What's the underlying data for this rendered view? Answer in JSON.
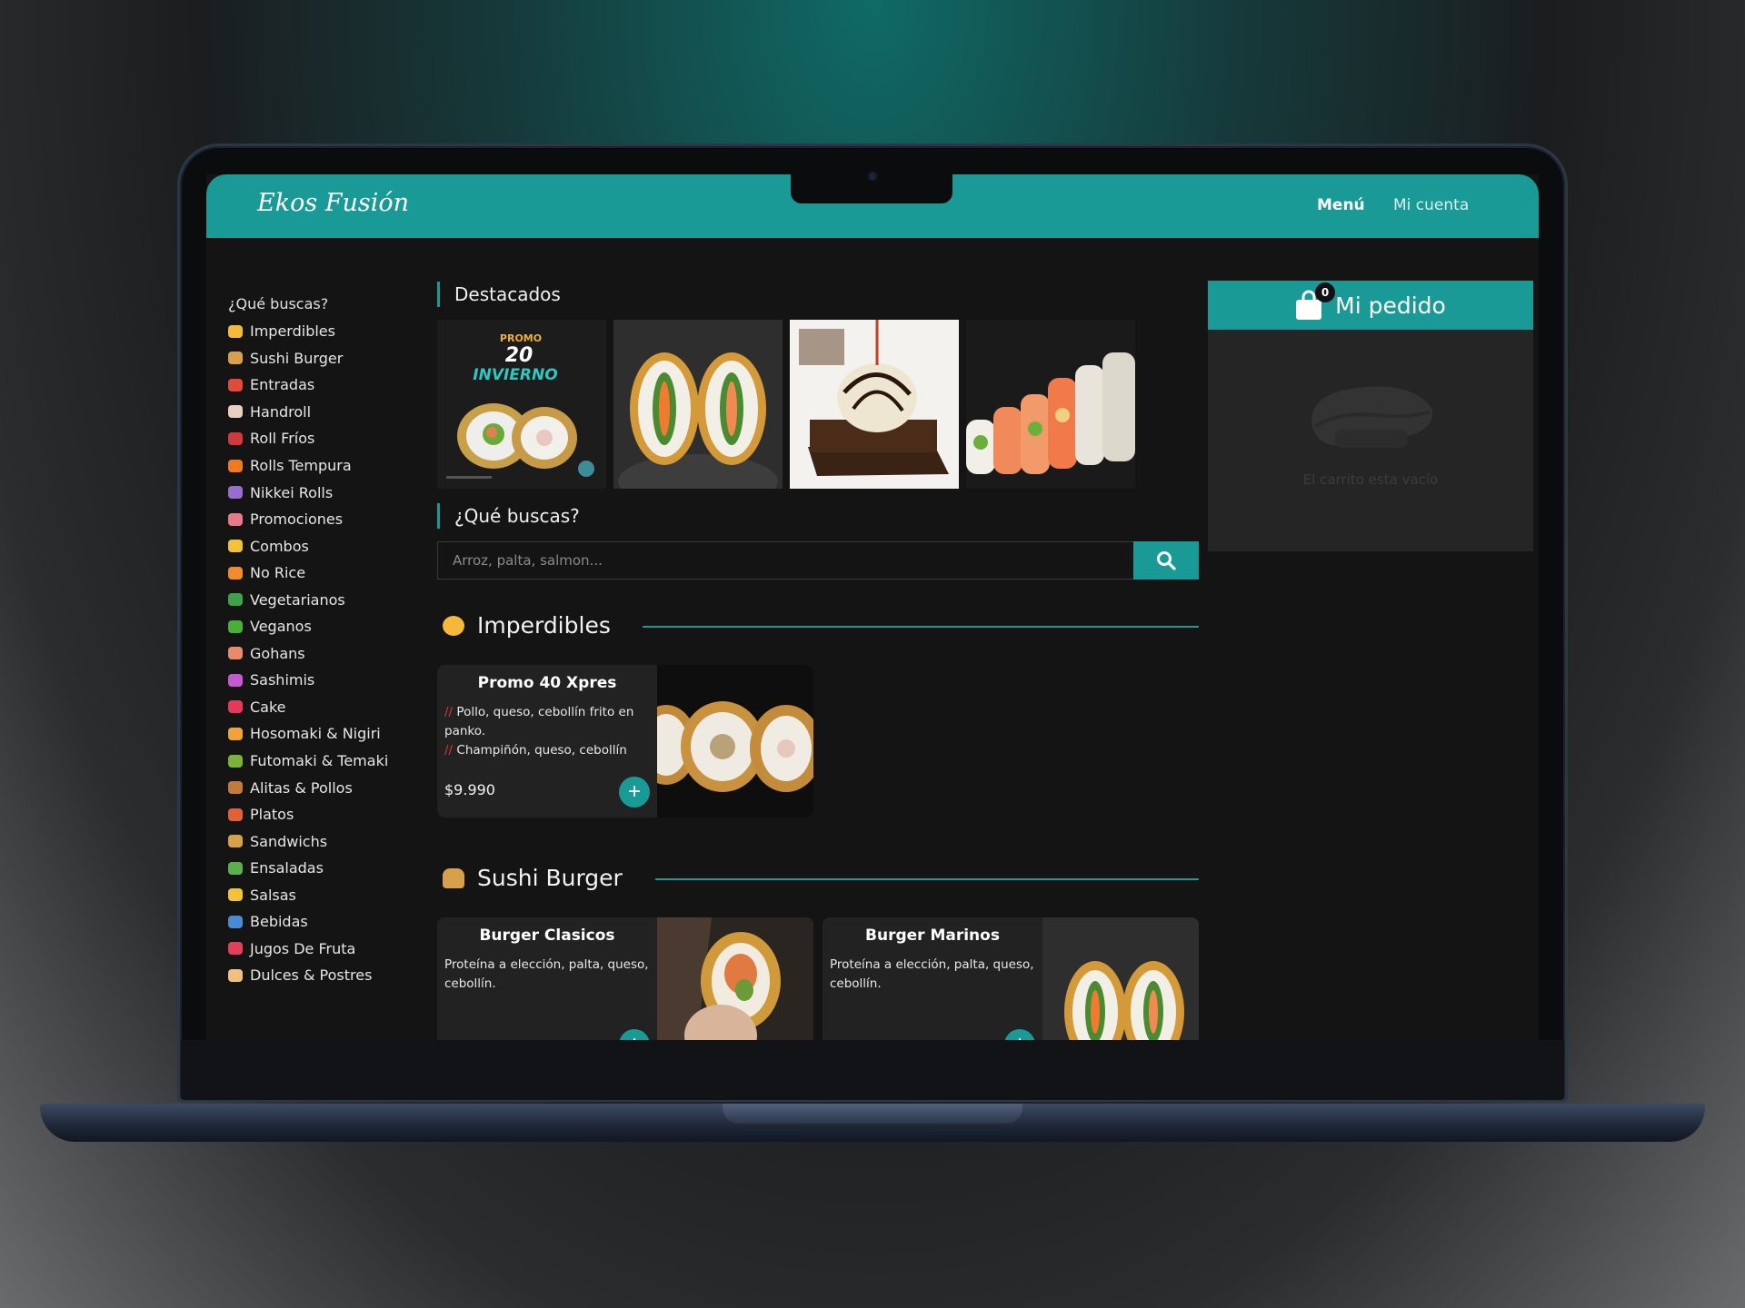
{
  "app": {
    "brand": "Ekos Fusión"
  },
  "nav": {
    "menu": "Menú",
    "account": "Mi cuenta"
  },
  "sidebar": {
    "heading": "¿Qué buscas?",
    "items": [
      {
        "label": "Imperdibles",
        "icon": "party-face-icon",
        "color": "#f5b83b"
      },
      {
        "label": "Sushi Burger",
        "icon": "burger-icon",
        "color": "#d8a04a"
      },
      {
        "label": "Entradas",
        "icon": "fries-icon",
        "color": "#e24a3b"
      },
      {
        "label": "Handroll",
        "icon": "pill-icon",
        "color": "#e8d0c0"
      },
      {
        "label": "Roll Fríos",
        "icon": "chopsticks-icon",
        "color": "#d03a3a"
      },
      {
        "label": "Rolls Tempura",
        "icon": "fire-icon",
        "color": "#f07a22"
      },
      {
        "label": "Nikkei Rolls",
        "icon": "peru-flag-icon",
        "color": "#9a6cd0"
      },
      {
        "label": "Promociones",
        "icon": "sushi-icon",
        "color": "#e67a8a"
      },
      {
        "label": "Combos",
        "icon": "dizzy-icon",
        "color": "#f2c23a"
      },
      {
        "label": "No Rice",
        "icon": "orange-heart-icon",
        "color": "#f28a2e"
      },
      {
        "label": "Vegetarianos",
        "icon": "shamrock-icon",
        "color": "#3fa24a"
      },
      {
        "label": "Veganos",
        "icon": "green-pepper-icon",
        "color": "#4cae3a"
      },
      {
        "label": "Gohans",
        "icon": "rice-bowl-icon",
        "color": "#e98a6a"
      },
      {
        "label": "Sashimis",
        "icon": "octopus-icon",
        "color": "#c35ad0"
      },
      {
        "label": "Cake",
        "icon": "heart-icon",
        "color": "#e8385a"
      },
      {
        "label": "Hosomaki & Nigiri",
        "icon": "mango-icon",
        "color": "#f3a23a"
      },
      {
        "label": "Futomaki & Temaki",
        "icon": "avocado-icon",
        "color": "#7ab23a"
      },
      {
        "label": "Alitas & Pollos",
        "icon": "drumstick-icon",
        "color": "#c47a3a"
      },
      {
        "label": "Platos",
        "icon": "noodles-icon",
        "color": "#e0603a"
      },
      {
        "label": "Sandwichs",
        "icon": "sandwich-icon",
        "color": "#d8a04a"
      },
      {
        "label": "Ensaladas",
        "icon": "salad-icon",
        "color": "#5ab04a"
      },
      {
        "label": "Salsas",
        "icon": "sparkles-icon",
        "color": "#f2c23a"
      },
      {
        "label": "Bebidas",
        "icon": "picture-icon",
        "color": "#4a8ad0"
      },
      {
        "label": "Jugos De Fruta",
        "icon": "cup-icon",
        "color": "#e0405a"
      },
      {
        "label": "Dulces & Postres",
        "icon": "cake-slice-icon",
        "color": "#f0c080"
      }
    ]
  },
  "featured": {
    "title": "Destacados",
    "promo": {
      "line1": "PROMO",
      "line2": "20",
      "line3": "INVIERNO"
    }
  },
  "search": {
    "title": "¿Qué buscas?",
    "placeholder": "Arroz, palta, salmon..."
  },
  "categories": {
    "imperdibles": {
      "title": "Imperdibles",
      "products": [
        {
          "name": "Promo 40 Xpres",
          "desc1": "Pollo, queso, cebollín frito en panko.",
          "desc2": "Champiñón, queso, cebollín",
          "price": "$9.990"
        }
      ]
    },
    "sushi_burger": {
      "title": "Sushi Burger",
      "products": [
        {
          "name": "Burger Clasicos",
          "desc": "Proteína a elección, palta, queso, cebollín."
        },
        {
          "name": "Burger Marinos",
          "desc": "Proteína a elección, palta, queso, cebollín."
        }
      ]
    }
  },
  "cart": {
    "title": "Mi pedido",
    "count": "0",
    "empty": "El carrito esta vacío"
  },
  "theme": {
    "accent": "#1a9a97"
  }
}
